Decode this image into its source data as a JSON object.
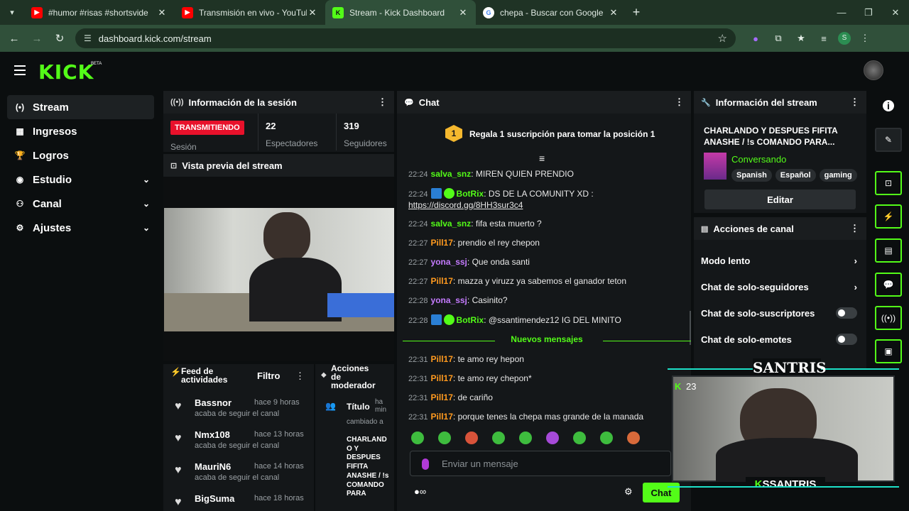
{
  "browser": {
    "tabs": [
      {
        "title": "#humor #risas #shortsvide",
        "icon": "youtube-icon",
        "active": false
      },
      {
        "title": "Transmisión en vivo - YouTube",
        "icon": "youtube-icon",
        "active": false
      },
      {
        "title": "Stream - Kick Dashboard",
        "icon": "kick-icon",
        "active": true
      },
      {
        "title": "chepa - Buscar con Google",
        "icon": "google-icon",
        "active": false
      }
    ],
    "url": "dashboard.kick.com/stream",
    "profile_initial": "S"
  },
  "app": {
    "logo": "KICK",
    "beta": "BETA"
  },
  "sidebar": {
    "items": [
      {
        "label": "Stream",
        "icon": "stream-icon"
      },
      {
        "label": "Ingresos",
        "icon": "income-icon"
      },
      {
        "label": "Logros",
        "icon": "trophy-icon"
      },
      {
        "label": "Estudio",
        "icon": "studio-icon"
      },
      {
        "label": "Canal",
        "icon": "channel-icon"
      },
      {
        "label": "Ajustes",
        "icon": "settings-icon"
      }
    ]
  },
  "session": {
    "title": "Información de la sesión",
    "status": "TRANSMITIENDO",
    "status_sub": "Sesión",
    "viewers": "22",
    "viewers_label": "Espectadores",
    "followers": "319",
    "followers_label": "Seguidores"
  },
  "preview": {
    "title": "Vista previa del stream"
  },
  "feed": {
    "title": "Feed de actividades",
    "filter": "Filtro",
    "items": [
      {
        "name": "Bassnor",
        "time": "hace 9 horas",
        "desc": "acaba de seguir el canal"
      },
      {
        "name": "Nmx108",
        "time": "hace 13 horas",
        "desc": "acaba de seguir el canal"
      },
      {
        "name": "MauriN6",
        "time": "hace 14 horas",
        "desc": "acaba de seguir el canal"
      },
      {
        "name": "BigSuma",
        "time": "hace 18 horas",
        "desc": ""
      }
    ]
  },
  "mod_actions": {
    "title": "Acciones de moderador",
    "item_title": "Título",
    "item_time": "ha min",
    "item_desc": "cambiado a",
    "item_value": "CHARLANDO Y DESPUES FIFITA ANASHE / !s COMANDO PARA"
  },
  "chat": {
    "title": "Chat",
    "pinned_rank": "1",
    "pinned": "Regala 1 suscripción para tomar la posición 1",
    "new_messages": "Nuevos mensajes",
    "input_placeholder": "Enviar un mensaje",
    "send_label": "Chat",
    "messages_before": [
      {
        "time": "22:24",
        "user": "salva_snz",
        "color": "#53fc18",
        "text": "MIREN QUIEN PRENDIO",
        "bot": false
      },
      {
        "time": "22:24",
        "user": "BotRix",
        "color": "#53fc18",
        "text": "DS DE LA COMUNITY XD :",
        "link": "https://discord.gg/8HH3sur3c4",
        "bot": true
      },
      {
        "time": "22:24",
        "user": "salva_snz",
        "color": "#53fc18",
        "text": "fifa esta muerto ?",
        "bot": false
      },
      {
        "time": "22:27",
        "user": "Pill17",
        "color": "#ff9a1f",
        "text": "prendio el rey chepon",
        "bot": false
      },
      {
        "time": "22:27",
        "user": "yona_ssj",
        "color": "#c57bff",
        "text": "Que onda santi",
        "bot": false
      },
      {
        "time": "22:27",
        "user": "Pill17",
        "color": "#ff9a1f",
        "text": "mazza y viruzz ya sabemos el ganador teton",
        "bot": false
      },
      {
        "time": "22:28",
        "user": "yona_ssj",
        "color": "#c57bff",
        "text": "Casinito?",
        "bot": false
      },
      {
        "time": "22:28",
        "user": "BotRix",
        "color": "#53fc18",
        "text": "@ssantimendez12 IG DEL MINITO",
        "bot": true
      }
    ],
    "messages_after": [
      {
        "time": "22:31",
        "user": "Pill17",
        "color": "#ff9a1f",
        "text": "te amo rey hepon"
      },
      {
        "time": "22:31",
        "user": "Pill17",
        "color": "#ff9a1f",
        "text": "te amo rey chepon*"
      },
      {
        "time": "22:31",
        "user": "Pill17",
        "color": "#ff9a1f",
        "text": "de cariño"
      },
      {
        "time": "22:31",
        "user": "Pill17",
        "color": "#ff9a1f",
        "text": "porque tenes la chepa mas grande de la manada"
      }
    ]
  },
  "stream_info": {
    "title": "Información del stream",
    "stream_title": "CHARLANDO Y DESPUES FIFITA ANASHE / !s COMANDO PARA...",
    "category": "Conversando",
    "tags": [
      "Spanish",
      "Español",
      "gaming"
    ],
    "edit_label": "Editar"
  },
  "channel_actions": {
    "title": "Acciones de canal",
    "items": [
      {
        "label": "Modo lento",
        "control": "chevron"
      },
      {
        "label": "Chat de solo-seguidores",
        "control": "chevron"
      },
      {
        "label": "Chat de solo-suscriptores",
        "control": "toggle"
      },
      {
        "label": "Chat de solo-emotes",
        "control": "toggle"
      }
    ]
  },
  "overlay": {
    "brand": "SANTRIS",
    "name": "SSANTRIS",
    "viewers": "23"
  },
  "colors": {
    "accent": "#53fc18",
    "live": "#e8112b",
    "panel": "#141719"
  }
}
